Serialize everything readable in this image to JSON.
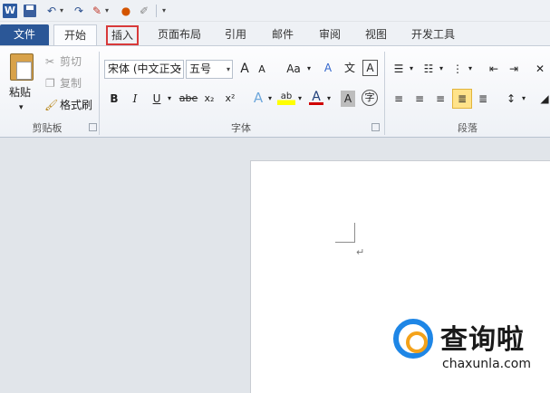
{
  "quick_access": {
    "app_icon_letter": "W",
    "icons": [
      "save-icon",
      "undo-icon",
      "redo-icon",
      "format-painter-icon",
      "color-icon",
      "pen-icon",
      "customize-icon"
    ]
  },
  "tabs": {
    "file": "文件",
    "home": "开始",
    "insert": "插入",
    "page_layout": "页面布局",
    "references": "引用",
    "mailings": "邮件",
    "review": "审阅",
    "view": "视图",
    "developer": "开发工具"
  },
  "clipboard": {
    "paste": "粘贴",
    "cut": "剪切",
    "copy": "复制",
    "format_painter": "格式刷",
    "group_label": "剪贴板"
  },
  "font": {
    "font_name": "宋体 (中文正文",
    "font_size": "五号",
    "grow": "A",
    "shrink": "A",
    "change_case": "Aa",
    "bold": "B",
    "italic": "I",
    "underline": "U",
    "strikethrough": "abe",
    "subscript": "x₂",
    "superscript": "x²",
    "highlight": "ab",
    "font_color": "A",
    "char_shading": "A",
    "enclose": "字",
    "clear_format": "A",
    "pinyin": "文",
    "border": "A",
    "group_label": "字体"
  },
  "paragraph": {
    "group_label": "段落"
  },
  "document": {
    "para_mark": "↵"
  },
  "watermark": {
    "title": "查询啦",
    "url": "chaxunla.com"
  },
  "colors": {
    "file_tab": "#2b5797",
    "highlight_box": "#d83a3a",
    "logo_blue": "#1e86e6",
    "logo_orange": "#f4a21a"
  }
}
